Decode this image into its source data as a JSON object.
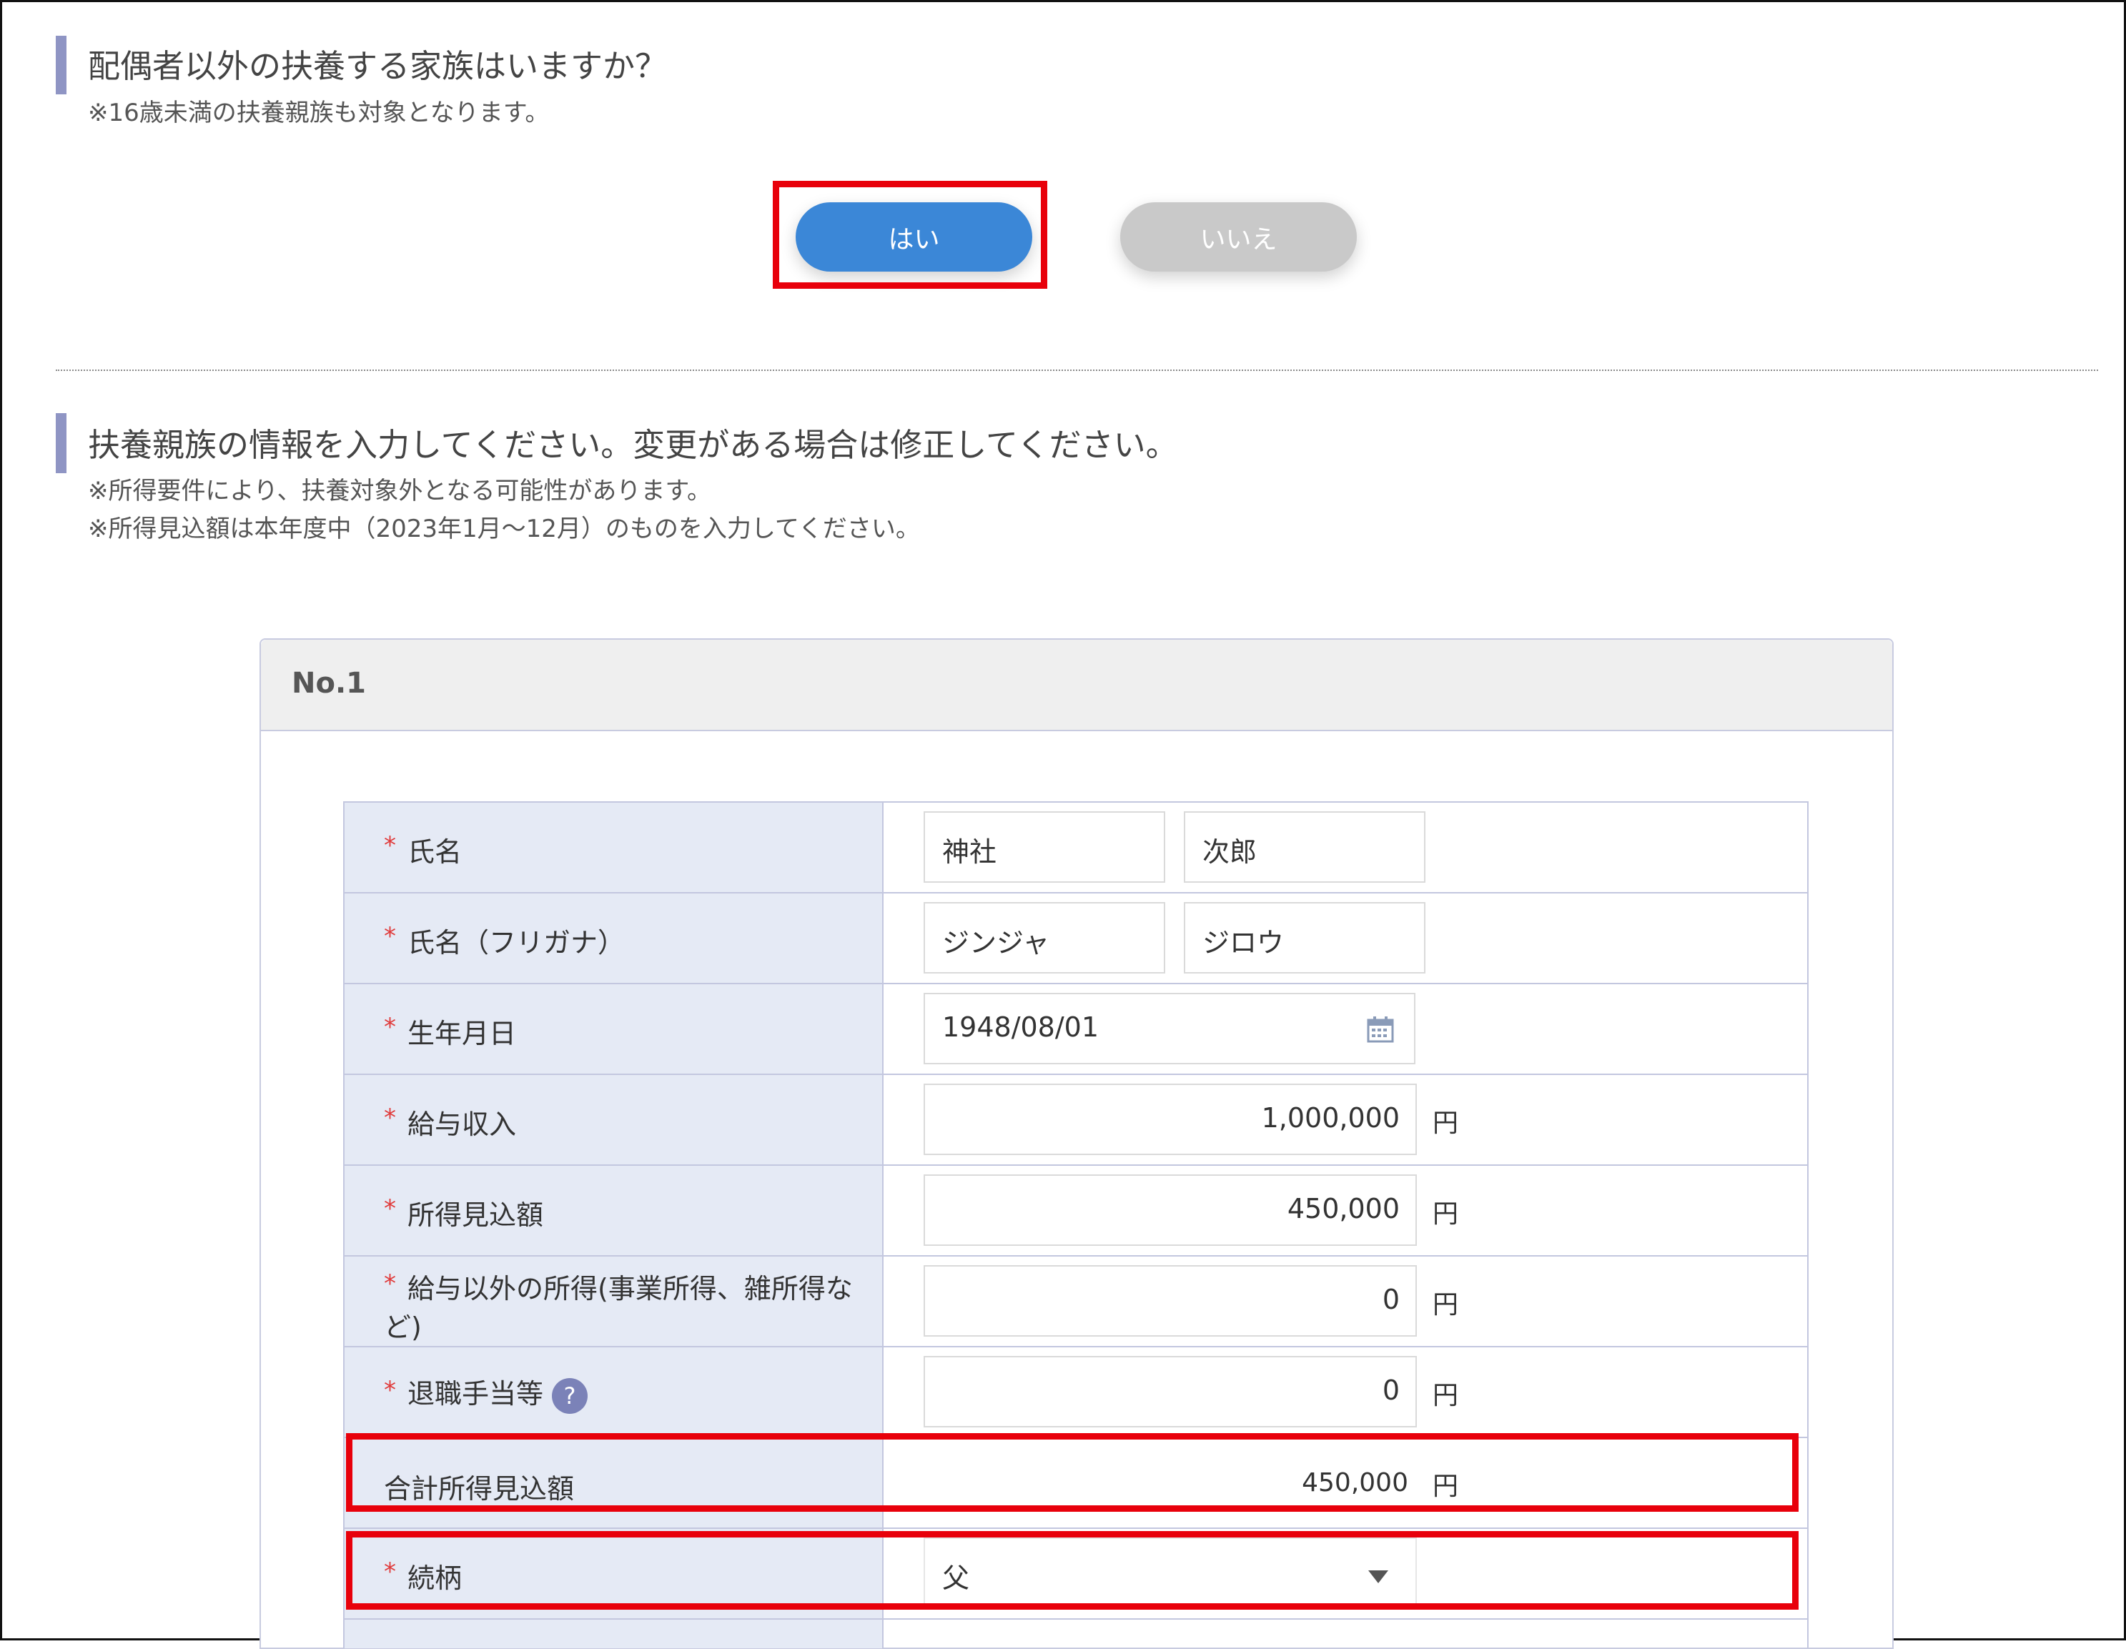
{
  "section1": {
    "title": "配偶者以外の扶養する家族はいますか？",
    "note": "※16歳未満の扶養親族も対象となります。",
    "yes_label": "はい",
    "no_label": "いいえ"
  },
  "section2": {
    "title": "扶養親族の情報を入力してください。変更がある場合は修正してください。",
    "note1": "※所得要件により、扶養対象外となる可能性があります。",
    "note2": "※所得見込額は本年度中（2023年1月～12月）のものを入力してください。"
  },
  "card": {
    "title": "No.1",
    "required_mark": "*",
    "currency": "円",
    "rows": {
      "name": {
        "label": "氏名",
        "last": "神社",
        "first": "次郎"
      },
      "kana": {
        "label": "氏名（フリガナ）",
        "last": "ジンジャ",
        "first": "ジロウ"
      },
      "birth": {
        "label": "生年月日",
        "value": "1948/08/01"
      },
      "salary": {
        "label": "給与収入",
        "value": "1,000,000"
      },
      "income_est": {
        "label": "所得見込額",
        "value": "450,000"
      },
      "other_income": {
        "label_line1": "給与以外の所得(事業所得、雑所得な",
        "label_line2": "ど)",
        "value": "0"
      },
      "retirement": {
        "label": "退職手当等",
        "help": "?",
        "value": "0"
      },
      "total": {
        "label": "合計所得見込額",
        "value": "450,000"
      },
      "relation": {
        "label": "続柄",
        "value": "父"
      }
    }
  },
  "colors": {
    "accent": "#3b87d7",
    "highlight": "#e8000b",
    "section_bar": "#8f95c4",
    "label_bg": "#e5eaf5"
  }
}
